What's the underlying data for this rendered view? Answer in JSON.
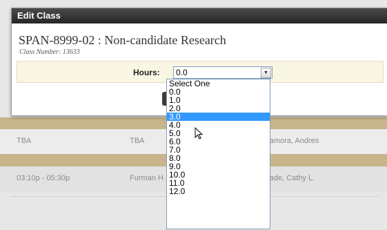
{
  "dialog": {
    "title": "Edit Class",
    "course_code": "SPAN-8999-02",
    "separator": ":",
    "course_name": "Non-candidate Research",
    "class_number": "Class Number: 13633"
  },
  "hours": {
    "label": "Hours:",
    "value": "0.0",
    "options": [
      "Select One",
      "0.0",
      "1.0",
      "2.0",
      "3.0",
      "4.0",
      "5.0",
      "6.0",
      "7.0",
      "8.0",
      "9.0",
      "10.0",
      "11.0",
      "12.0"
    ],
    "highlighted_option": "3.0"
  },
  "background_rows": [
    {
      "time": "TBA",
      "location": "TBA",
      "instructor": "Zamora, Andres"
    },
    {
      "time": "03:10p - 05:30p",
      "location": "Furman H",
      "instructor": "Irade, Cathy L."
    }
  ],
  "icons": {
    "dropdown_arrow": "chevron-down-icon",
    "cursor": "mouse-pointer-icon"
  },
  "colors": {
    "titlebar": "#333333",
    "highlight": "#3399ff",
    "band": "#faf6e4",
    "section_bar": "#c8b58c"
  }
}
